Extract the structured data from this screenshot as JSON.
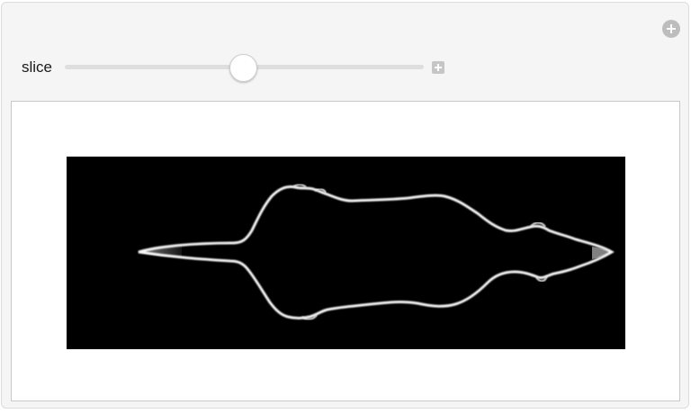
{
  "controls": {
    "slice_label": "slice",
    "slice_value": 0.5
  },
  "icons": {
    "add": "plus-circle-icon",
    "expand": "plus-square-icon"
  },
  "colors": {
    "panel_bg": "#f5f5f5",
    "image_bg": "#000000",
    "contour": "#ffffff"
  }
}
